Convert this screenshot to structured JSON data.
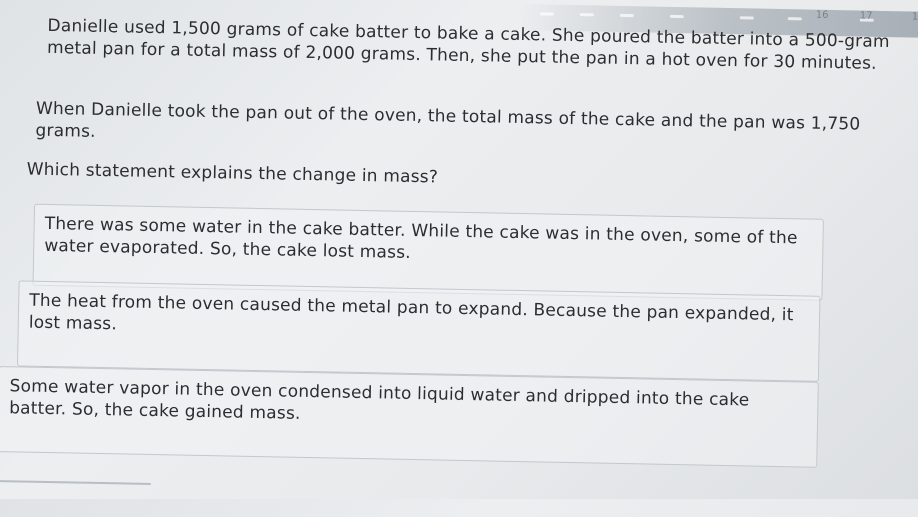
{
  "header": {
    "page_numbers": [
      "16",
      "17",
      "1"
    ]
  },
  "question": {
    "paragraph1": "Danielle used 1,500 grams of cake batter to bake a cake. She poured the batter into a 500-gram metal pan for a total mass of 2,000 grams. Then, she put the pan in a hot oven for 30 minutes.",
    "paragraph2": "When Danielle took the pan out of the oven, the total mass of the cake and the pan was 1,750 grams.",
    "prompt": "Which statement explains the change in mass?"
  },
  "choices": [
    {
      "text": "There was some water in the cake batter. While the cake was in the oven, some of the water evaporated. So, the cake lost mass."
    },
    {
      "text": "The heat from the oven caused the metal pan to expand. Because the pan expanded, it lost mass."
    },
    {
      "text": "Some water vapor in the oven condensed into liquid water and dripped into the cake batter. So, the cake gained mass."
    }
  ]
}
